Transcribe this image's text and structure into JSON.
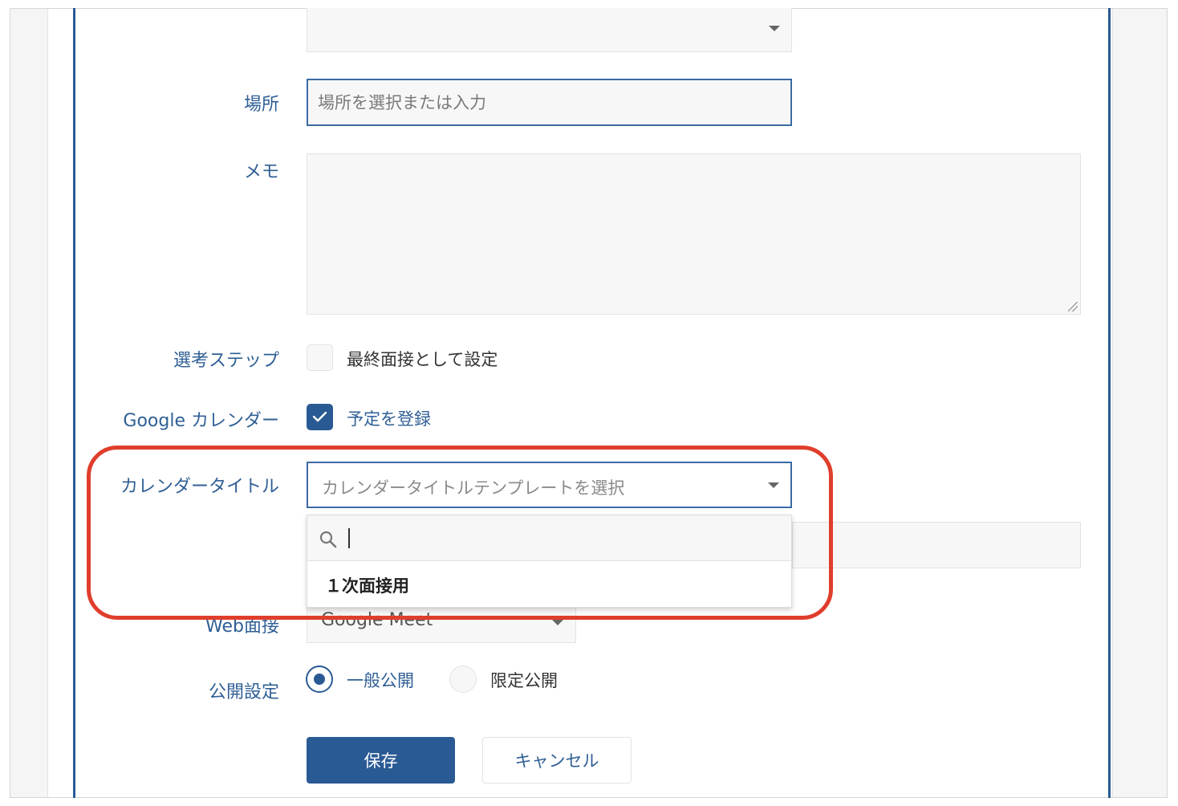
{
  "form": {
    "location": {
      "label": "場所",
      "placeholder": "場所を選択または入力"
    },
    "memo": {
      "label": "メモ"
    },
    "selection_step": {
      "label": "選考ステップ",
      "option": "最終面接として設定",
      "checked": false
    },
    "google_calendar": {
      "label": "Google カレンダー",
      "option": "予定を登録",
      "checked": true
    },
    "calendar_title": {
      "label": "カレンダータイトル",
      "placeholder": "カレンダータイトルテンプレートを選択",
      "dropdown_items": [
        "１次面接用"
      ]
    },
    "web_interview": {
      "label": "Web面接",
      "value": "Google Meet"
    },
    "visibility": {
      "label": "公開設定",
      "options": [
        "一般公開",
        "限定公開"
      ],
      "selected": "一般公開"
    }
  },
  "buttons": {
    "save": "保存",
    "cancel": "キャンセル"
  },
  "colors": {
    "accent": "#2a5a94",
    "highlight": "#e03e2d",
    "field_bg": "#f7f7f7"
  },
  "icons": [
    "chevron-down-icon",
    "search-icon",
    "check-icon",
    "resize-handle-icon"
  ]
}
